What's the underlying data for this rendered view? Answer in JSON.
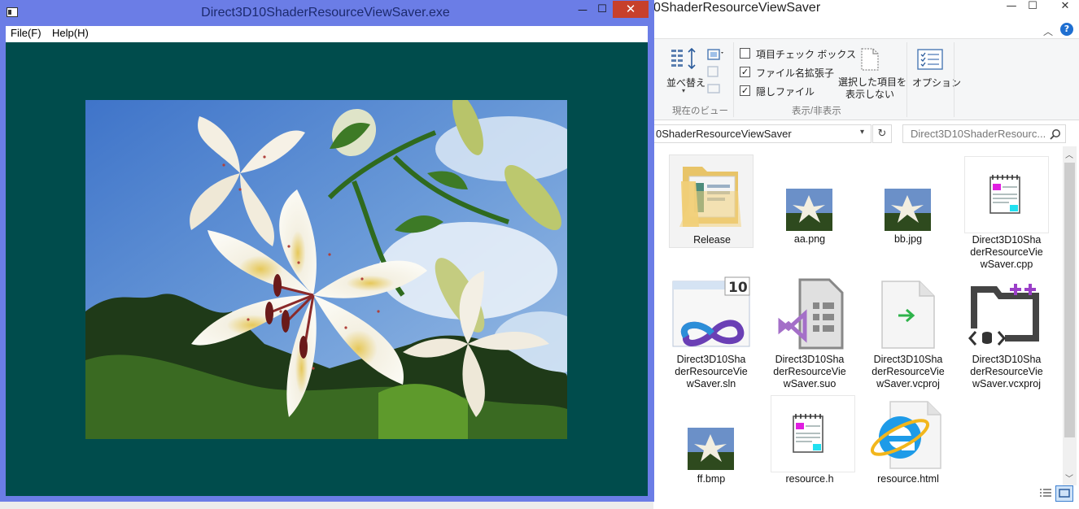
{
  "explorer": {
    "title": "0ShaderResourceViewSaver",
    "ribbon": {
      "sort_label": "並べ替え",
      "view_group": "現在のビュー",
      "checkboxes": [
        {
          "label": "項目チェック ボックス",
          "checked": false
        },
        {
          "label": "ファイル名拡張子",
          "checked": true
        },
        {
          "label": "隠しファイル",
          "checked": true
        }
      ],
      "hide_selected": "選択した項目を表示しない",
      "hide_selected_line1": "選択した項目を",
      "hide_selected_line2": "表示しない",
      "show_hide_group": "表示/非表示",
      "options_label": "オプション"
    },
    "address": "0ShaderResourceViewSaver",
    "search_placeholder": "Direct3D10ShaderResourc...",
    "files": [
      {
        "name": "Release",
        "lines": [
          "Release"
        ],
        "icon": "folder-icon"
      },
      {
        "name": "aa.png",
        "lines": [
          "aa.png"
        ],
        "icon": "image-thumbnail-icon"
      },
      {
        "name": "bb.jpg",
        "lines": [
          "bb.jpg"
        ],
        "icon": "image-thumbnail-icon"
      },
      {
        "name": "Direct3D10ShaderResourceViewSaver.cpp",
        "lines": [
          "Direct3D10Sha",
          "derResourceVie",
          "wSaver.cpp"
        ],
        "icon": "cpp-file-icon"
      },
      {
        "name": "Direct3D10ShaderResourceViewSaver.sln",
        "lines": [
          "Direct3D10Sha",
          "derResourceVie",
          "wSaver.sln"
        ],
        "icon": "solution-file-icon"
      },
      {
        "name": "Direct3D10ShaderResourceViewSaver.suo",
        "lines": [
          "Direct3D10Sha",
          "derResourceVie",
          "wSaver.suo"
        ],
        "icon": "suo-file-icon"
      },
      {
        "name": "Direct3D10ShaderResourceViewSaver.vcproj",
        "lines": [
          "Direct3D10Sha",
          "derResourceVie",
          "wSaver.vcproj"
        ],
        "icon": "vcproj-file-icon"
      },
      {
        "name": "Direct3D10ShaderResourceViewSaver.vcxproj",
        "lines": [
          "Direct3D10Sha",
          "derResourceVie",
          "wSaver.vcxproj"
        ],
        "icon": "vcxproj-file-icon"
      },
      {
        "name": "ff.bmp",
        "lines": [
          "ff.bmp"
        ],
        "icon": "image-thumbnail-icon"
      },
      {
        "name": "resource.h",
        "lines": [
          "resource.h"
        ],
        "icon": "header-file-icon"
      },
      {
        "name": "resource.html",
        "lines": [
          "resource.html"
        ],
        "icon": "ie-html-icon"
      }
    ]
  },
  "app": {
    "title": "Direct3D10ShaderResourceViewSaver.exe",
    "menu": [
      {
        "label": "File(F)"
      },
      {
        "label": "Help(H)"
      }
    ],
    "close_glyph": "✕",
    "minimize_glyph": "—",
    "maximize_glyph": "☐"
  },
  "colors": {
    "frame": "#6b7de6",
    "client": "#004c4c",
    "close": "#c7402b"
  }
}
